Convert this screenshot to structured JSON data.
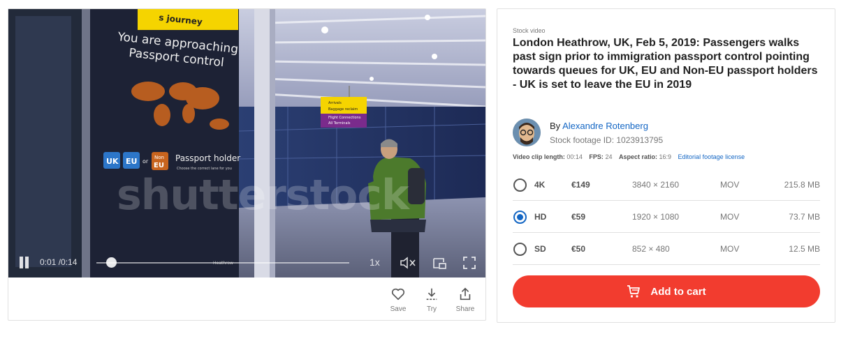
{
  "video": {
    "sign_text_1": "You are approaching",
    "sign_text_2": "Passport control",
    "sign_banner": "s journey",
    "sign_uk": "UK",
    "sign_eu": "EU",
    "sign_or": "or",
    "sign_non_eu_1": "Non",
    "sign_non_eu_2": "EU",
    "sign_holder": "Passport holder",
    "sign_choose": "Choose the correct lane for you",
    "sign_heathrow": "Heathrow",
    "arrivals_1": "Arrivals",
    "arrivals_2": "Baggage reclaim",
    "arrivals_3": "Flight Connections",
    "arrivals_4": "All Terminals",
    "watermark": "shutterstock",
    "time": "0:01 /0:14",
    "speed": "1x",
    "progress": 0.06
  },
  "actions": {
    "save": "Save",
    "try": "Try",
    "share": "Share"
  },
  "info": {
    "eyebrow": "Stock video",
    "title": "London Heathrow, UK, Feb 5, 2019: Passengers walks past sign prior to immigration passport control pointing towards queues for UK, EU and Non-EU passport holders - UK is set to leave the EU in 2019",
    "by_prefix": "By",
    "author": "Alexandre Rotenberg",
    "footage_id": "Stock footage ID: 1023913795",
    "meta": {
      "length_label": "Video clip length:",
      "length_value": "00:14",
      "fps_label": "FPS:",
      "fps_value": "24",
      "aspect_label": "Aspect ratio:",
      "aspect_value": "16:9",
      "license": "Editorial footage license"
    },
    "options": [
      {
        "res": "4K",
        "price": "€149",
        "dim": "3840 × 2160",
        "format": "MOV",
        "size": "215.8 MB",
        "selected": false
      },
      {
        "res": "HD",
        "price": "€59",
        "dim": "1920 × 1080",
        "format": "MOV",
        "size": "73.7 MB",
        "selected": true
      },
      {
        "res": "SD",
        "price": "€50",
        "dim": "852 × 480",
        "format": "MOV",
        "size": "12.5 MB",
        "selected": false
      }
    ],
    "cart_label": "Add to cart"
  },
  "colors": {
    "accent": "#f23c2f",
    "link": "#1366c4"
  }
}
